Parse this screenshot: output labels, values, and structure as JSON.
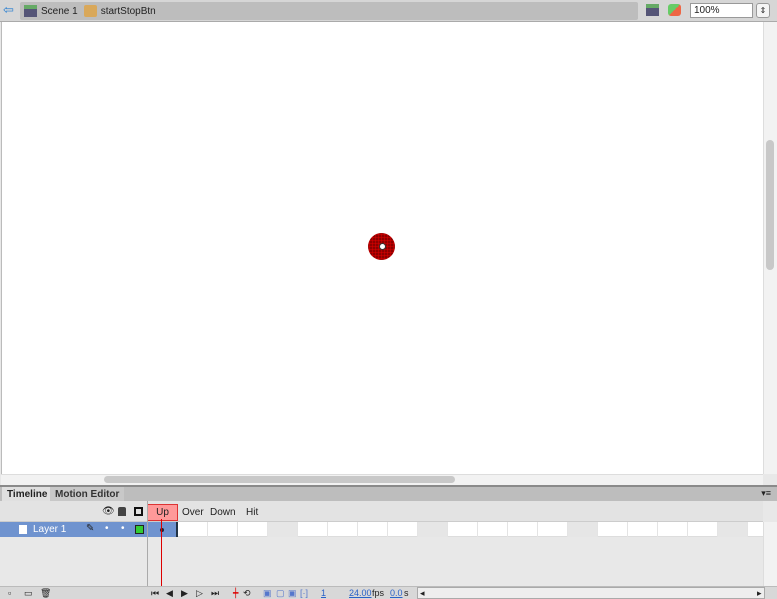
{
  "breadcrumb": {
    "scene": "Scene 1",
    "symbol": "startStopBtn"
  },
  "zoom": {
    "value": "100%"
  },
  "panel": {
    "tabs": [
      "Timeline",
      "Motion Editor"
    ]
  },
  "timeline": {
    "frame_labels": [
      "Up",
      "Over",
      "Down",
      "Hit"
    ],
    "layers": [
      {
        "name": "Layer 1"
      }
    ],
    "current_frame": "1",
    "fps": "24.00",
    "fps_unit": "fps",
    "time": "0.0",
    "time_unit": "s"
  },
  "icons": {
    "back": "arrow-left-icon",
    "scene": "clapper-icon",
    "symbol": "button-symbol-icon",
    "edit_scene": "clapper-icon",
    "edit_symbol": "shapes-icon"
  },
  "colors": {
    "layer_selected": "#6f93cf",
    "up_frame": "#ff9999",
    "playhead": "#dd0000",
    "layer_color": "#33cc33"
  }
}
